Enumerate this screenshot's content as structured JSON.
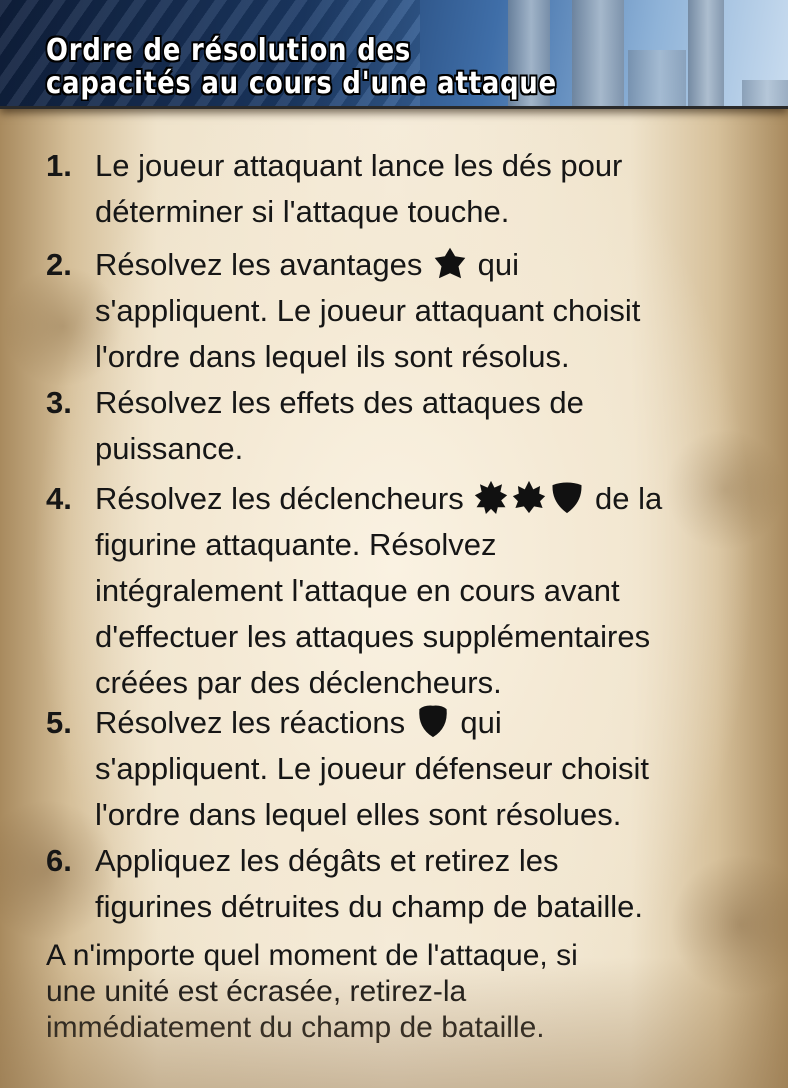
{
  "header": {
    "title": "Ordre de résolution des capacités au cours d'une attaque"
  },
  "steps": [
    {
      "number": "1.",
      "lines": [
        "Le joueur attaquant lance les dés pour",
        "déterminer si l'attaque touche."
      ]
    },
    {
      "number": "2.",
      "line1_before": "Résolvez les avantages",
      "line1_after": "qui",
      "lines": [
        "s'appliquent. Le joueur attaquant choisit",
        "l'ordre dans lequel ils sont résolus."
      ],
      "icons": [
        "advantage-star-icon"
      ]
    },
    {
      "number": "3.",
      "lines": [
        "Résolvez les effets des attaques de",
        "puissance."
      ]
    },
    {
      "number": "4.",
      "line1_before": "Résolvez les déclencheurs",
      "line1_after": "de la",
      "lines": [
        "figurine attaquante. Résolvez",
        "intégralement l'attaque en cours avant",
        "d'effectuer les attaques supplémentaires",
        "créées par des déclencheurs."
      ],
      "icons": [
        "trigger-burst-icon",
        "trigger-leaf-icon",
        "trigger-shield-icon"
      ]
    },
    {
      "number": "5.",
      "line1_before": "Résolvez les réactions",
      "line1_after": "qui",
      "lines": [
        "s'appliquent. Le joueur défenseur choisit",
        "l'ordre dans lequel elles sont résolues."
      ],
      "icons": [
        "reaction-shield-icon"
      ]
    },
    {
      "number": "6.",
      "lines": [
        "Appliquez les dégâts et retirez les",
        "figurines détruites du champ de bataille."
      ]
    }
  ],
  "footer_note": {
    "lines": [
      "A n'importe quel moment de l'attaque, si",
      "une unité est écrasée, retirez-la",
      "immédiatement du champ de bataille."
    ]
  }
}
